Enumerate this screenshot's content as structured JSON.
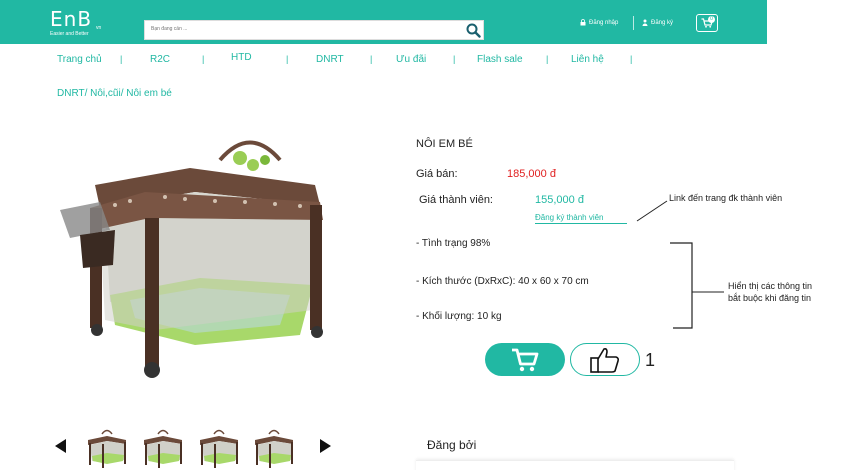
{
  "header": {
    "logo": {
      "main": "EnB",
      "sub": "vn",
      "tagline": "Easier and Better"
    },
    "search": {
      "placeholder": "Bạn đang cần ..."
    },
    "login_label": "Đăng nhập",
    "register_label": "Đăng ký",
    "cart_count": "0"
  },
  "nav": {
    "items": [
      "Trang chủ",
      "R2C",
      "HTD",
      "DNRT",
      "Ưu đãi",
      "Flash sale",
      "Liên hệ"
    ],
    "separator": "|"
  },
  "breadcrumb": "DNRT/ Nôi,cũi/ Nôi em bé",
  "product": {
    "title": "NÔI EM BÉ",
    "price_label": "Giá bán:",
    "price": "185,000 đ",
    "member_price_label": "Giá thành viên:",
    "member_price": "155,000 đ",
    "member_link": "Đăng ký thành viên",
    "specs": [
      "- Tình trạng 98%",
      "- Kích thước (DxRxC): 40 x 60 x 70 cm",
      "- Khối lượng: 10 kg"
    ],
    "like_count": "1",
    "price_color": "#e02020",
    "accent_color": "#21b8a3"
  },
  "annotations": {
    "member_note": "Link đến trang đk thành viên",
    "info_note_line1": "Hiển thị các thông tin",
    "info_note_line2": "bắt buộc khi đăng tin"
  },
  "gallery": {
    "thumbnail_count": 4
  },
  "poster": {
    "label": "Đăng bởi"
  }
}
